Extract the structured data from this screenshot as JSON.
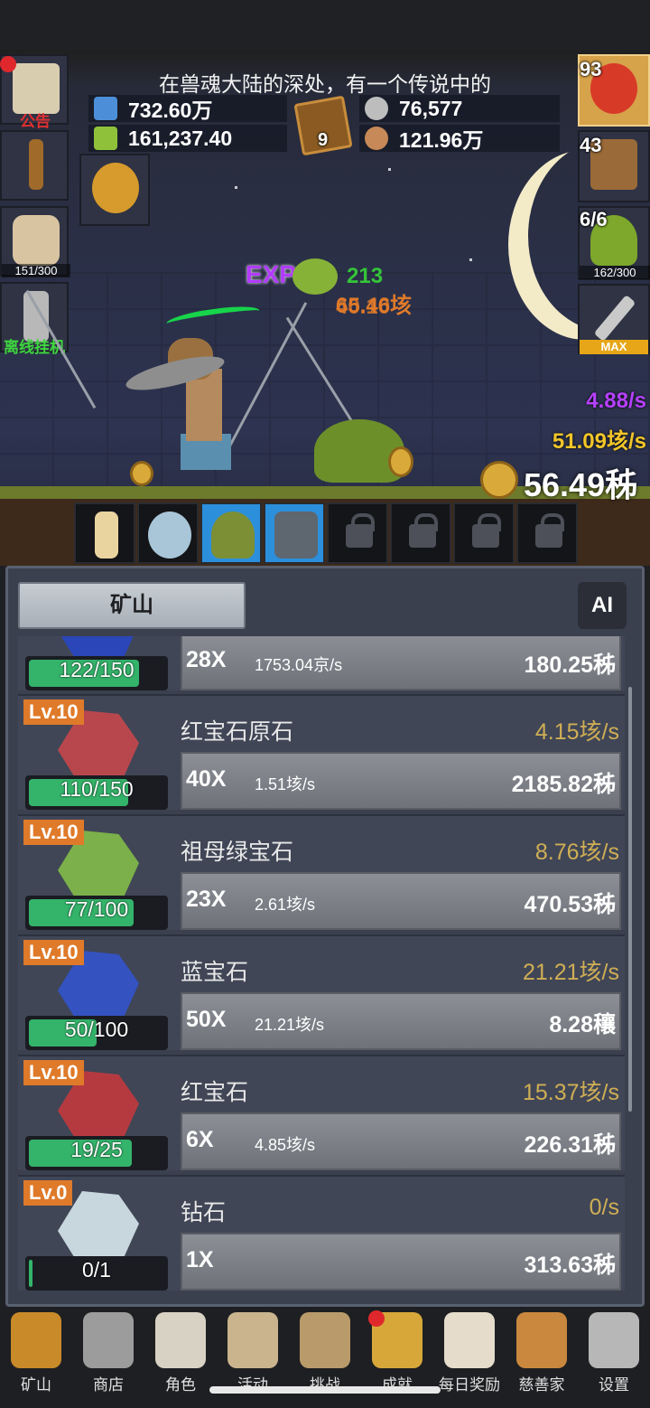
{
  "ticker": "在兽魂大陆的深处，有一个传说中的",
  "resources": {
    "blue_potion": "732.60万",
    "green_potion": "161,237.40",
    "book_count": "9",
    "coins": "76,577",
    "meat": "121.96万"
  },
  "left_buttons": {
    "notice_label": "公告",
    "food_progress": "151/300",
    "offline_label": "离线挂机"
  },
  "right_buttons": {
    "potion_count": "93",
    "chest_count": "43",
    "slime_count": "6/6",
    "slime_progress": "162/300",
    "sword_badge": "MAX"
  },
  "rates": {
    "exp_rate": "4.88/s",
    "gold_rate": "51.09垓/s"
  },
  "total_gold": "56.49秭",
  "floating": {
    "exp": "EXP",
    "exp_gain": "213",
    "gold_gain": "65.46垓",
    "gold_gain_2": "40.10"
  },
  "tab": {
    "mine_label": "矿山",
    "ai_label": "AI"
  },
  "ores": [
    {
      "level": "",
      "name": "",
      "rate": "",
      "mult": "28X",
      "sub": "1753.04京/s",
      "cost": "180.25秭",
      "progress": "122/150",
      "fill": 0.81,
      "color": "#2b46b8"
    },
    {
      "level": "Lv.10",
      "name": "红宝石原石",
      "rate": "4.15垓/s",
      "mult": "40X",
      "sub": "1.51垓/s",
      "cost": "2185.82秭",
      "progress": "110/150",
      "fill": 0.73,
      "color": "#b8474d"
    },
    {
      "level": "Lv.10",
      "name": "祖母绿宝石",
      "rate": "8.76垓/s",
      "mult": "23X",
      "sub": "2.61垓/s",
      "cost": "470.53秭",
      "progress": "77/100",
      "fill": 0.77,
      "color": "#7bb04a"
    },
    {
      "level": "Lv.10",
      "name": "蓝宝石",
      "rate": "21.21垓/s",
      "mult": "50X",
      "sub": "21.21垓/s",
      "cost": "8.28穰",
      "progress": "50/100",
      "fill": 0.5,
      "color": "#3452c0"
    },
    {
      "level": "Lv.10",
      "name": "红宝石",
      "rate": "15.37垓/s",
      "mult": "6X",
      "sub": "4.85垓/s",
      "cost": "226.31秭",
      "progress": "19/25",
      "fill": 0.76,
      "color": "#b53a40"
    },
    {
      "level": "Lv.0",
      "name": "钻石",
      "rate": "0/s",
      "mult": "1X",
      "sub": "",
      "cost": "313.63秭",
      "progress": "0/1",
      "fill": 0.02,
      "color": "#c8d6dd"
    }
  ],
  "nav": [
    {
      "label": "矿山",
      "icon": "lantern-icon",
      "color": "#c98a2a"
    },
    {
      "label": "商店",
      "icon": "shop-icon",
      "color": "#9c9c9c"
    },
    {
      "label": "角色",
      "icon": "skull-icon",
      "color": "#d8d2c4"
    },
    {
      "label": "活动",
      "icon": "scroll-icon",
      "color": "#c9b48e"
    },
    {
      "label": "挑战",
      "icon": "map-icon",
      "color": "#b99a6a"
    },
    {
      "label": "成就",
      "icon": "key-icon",
      "color": "#d7a73a"
    },
    {
      "label": "每日奖励",
      "icon": "envelope-icon",
      "color": "#e5dccb"
    },
    {
      "label": "慈善家",
      "icon": "bread-icon",
      "color": "#c9883e"
    },
    {
      "label": "设置",
      "icon": "gear-icon",
      "color": "#b7b7b7"
    }
  ]
}
